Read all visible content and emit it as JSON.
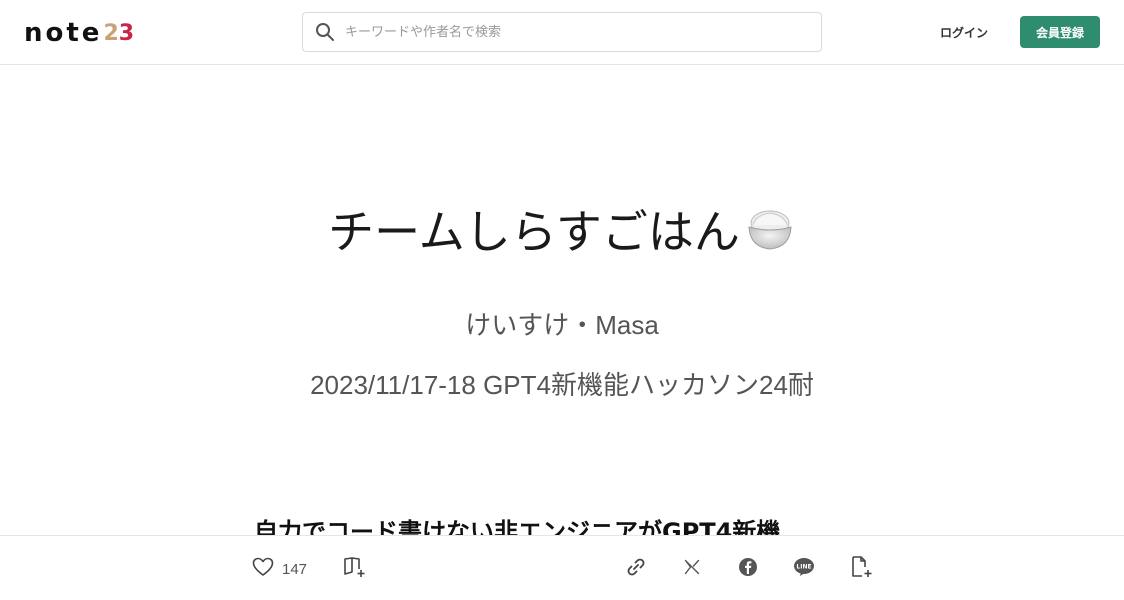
{
  "header": {
    "logo_text": "note",
    "logo_year_a": "2",
    "logo_year_b": "3",
    "search_placeholder": "キーワードや作者名で検索",
    "login_label": "ログイン",
    "signup_label": "会員登録"
  },
  "cover": {
    "title": "チームしらすごはん",
    "authors": "けいすけ・Masa",
    "event": "2023/11/17-18 GPT4新機能ハッカソン24耐"
  },
  "article": {
    "heading": "自力でコード書けない非エンジニアがGPT4新機"
  },
  "bottom_bar": {
    "like_count": "147"
  },
  "icons": {
    "search": "search-icon",
    "rice": "rice-bowl-icon",
    "like": "heart-icon",
    "magazine": "magazine-add-icon",
    "link": "link-icon",
    "x": "x-icon",
    "facebook": "facebook-icon",
    "line": "line-icon",
    "clip": "document-add-icon"
  },
  "colors": {
    "accent": "#2e8c6f",
    "logo_year": "#c8244c",
    "text": "#222222",
    "muted": "#555555"
  }
}
